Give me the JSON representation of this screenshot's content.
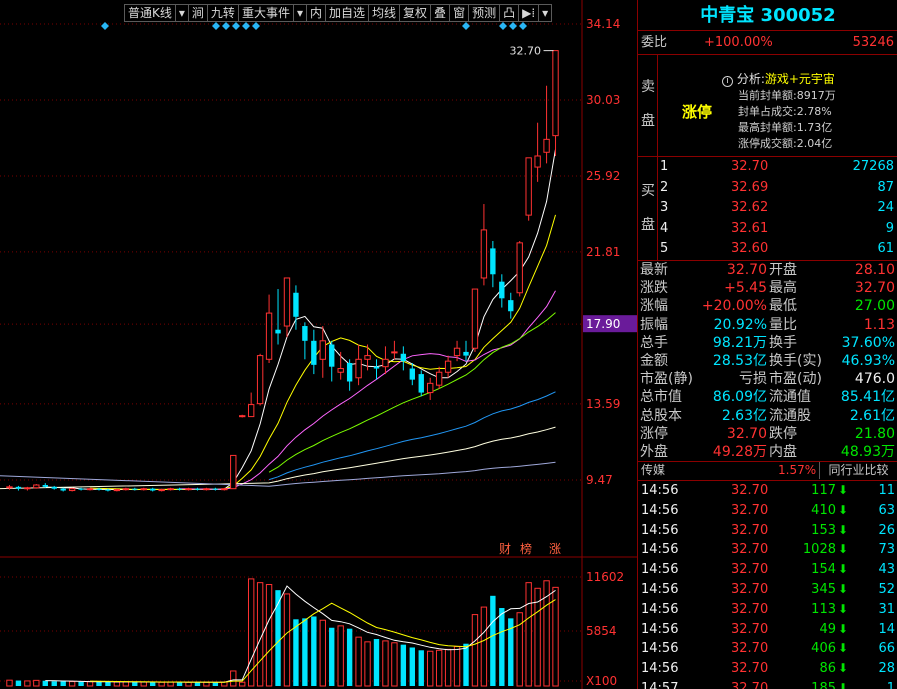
{
  "toolbar": {
    "items": [
      "普通K线",
      "▾",
      "涧",
      "九转",
      "重大事件",
      "▾",
      "内",
      "加自选",
      "均线",
      "复权",
      "叠",
      "窗",
      "预测",
      "凸",
      "▶⁞",
      "▾"
    ]
  },
  "chart": {
    "price_ticks": [
      "34.14",
      "30.03",
      "25.92",
      "21.81",
      "17.90",
      "13.59",
      "9.47"
    ],
    "high_label": "32.70",
    "highlight_price": "17.90",
    "volume_ticks": [
      "11602",
      "5854",
      "X100"
    ],
    "tags": [
      "财",
      "榜",
      "涨"
    ],
    "colors": {
      "up": "#ff3232",
      "down": "#00e5ff",
      "bg": "#000000",
      "grid": "#7a0000"
    }
  },
  "stock": {
    "title": "中青宝 300052",
    "weibi_label": "委比",
    "weibi_pct": "+100.00%",
    "weibi_num": "53246",
    "sell_label_1": "卖",
    "sell_label_2": "盘",
    "limit_up": "涨停",
    "analysis_title": "分析:",
    "analysis_topic": "游戏+元宇宙",
    "analysis_lines": [
      "当前封单额:8917万",
      "封单占成交:2.78%",
      "最高封单额:1.73亿",
      "涨停成交额:2.04亿"
    ],
    "buy_label_1": "买",
    "buy_label_2": "盘",
    "bids": [
      {
        "lvl": "1",
        "price": "32.70",
        "vol": "27268"
      },
      {
        "lvl": "2",
        "price": "32.69",
        "vol": "87"
      },
      {
        "lvl": "3",
        "price": "32.62",
        "vol": "24"
      },
      {
        "lvl": "4",
        "price": "32.61",
        "vol": "9"
      },
      {
        "lvl": "5",
        "price": "32.60",
        "vol": "61"
      }
    ],
    "stats": [
      {
        "l1": "最新",
        "v1": "32.70",
        "c1": "red",
        "l2": "开盘",
        "v2": "28.10",
        "c2": "red"
      },
      {
        "l1": "涨跌",
        "v1": "+5.45",
        "c1": "red",
        "l2": "最高",
        "v2": "32.70",
        "c2": "red"
      },
      {
        "l1": "涨幅",
        "v1": "+20.00%",
        "c1": "red",
        "l2": "最低",
        "v2": "27.00",
        "c2": "green"
      },
      {
        "l1": "振幅",
        "v1": "20.92%",
        "c1": "cyan",
        "l2": "量比",
        "v2": "1.13",
        "c2": "red"
      },
      {
        "l1": "总手",
        "v1": "98.21万",
        "c1": "cyan",
        "l2": "换手",
        "v2": "37.60%",
        "c2": "cyan"
      },
      {
        "l1": "金额",
        "v1": "28.53亿",
        "c1": "cyan",
        "l2": "换手(实)",
        "v2": "46.93%",
        "c2": "cyan"
      },
      {
        "l1": "市盈(静)",
        "v1": "亏损",
        "c1": "gray",
        "l2": "市盈(动)",
        "v2": "476.0",
        "c2": "white"
      },
      {
        "l1": "总市值",
        "v1": "86.09亿",
        "c1": "cyan",
        "l2": "流通值",
        "v2": "85.41亿",
        "c2": "cyan"
      },
      {
        "l1": "总股本",
        "v1": "2.63亿",
        "c1": "cyan",
        "l2": "流通股",
        "v2": "2.61亿",
        "c2": "cyan"
      },
      {
        "l1": "涨停",
        "v1": "32.70",
        "c1": "red",
        "l2": "跌停",
        "v2": "21.80",
        "c2": "green"
      },
      {
        "l1": "外盘",
        "v1": "49.28万",
        "c1": "red",
        "l2": "内盘",
        "v2": "48.93万",
        "c2": "green"
      }
    ],
    "industry": "传媒",
    "industry_pct": "1.57%",
    "compare_label": "同行业比较",
    "trades": [
      {
        "t": "14:56",
        "p": "32.70",
        "v": "117",
        "n": "11"
      },
      {
        "t": "14:56",
        "p": "32.70",
        "v": "410",
        "n": "63"
      },
      {
        "t": "14:56",
        "p": "32.70",
        "v": "153",
        "n": "26"
      },
      {
        "t": "14:56",
        "p": "32.70",
        "v": "1028",
        "n": "73"
      },
      {
        "t": "14:56",
        "p": "32.70",
        "v": "154",
        "n": "43"
      },
      {
        "t": "14:56",
        "p": "32.70",
        "v": "345",
        "n": "52"
      },
      {
        "t": "14:56",
        "p": "32.70",
        "v": "113",
        "n": "31"
      },
      {
        "t": "14:56",
        "p": "32.70",
        "v": "49",
        "n": "14"
      },
      {
        "t": "14:56",
        "p": "32.70",
        "v": "406",
        "n": "66"
      },
      {
        "t": "14:56",
        "p": "32.70",
        "v": "86",
        "n": "28"
      },
      {
        "t": "14:57",
        "p": "32.70",
        "v": "185",
        "n": "1"
      }
    ]
  },
  "candles": [
    {
      "o": 9.05,
      "c": 9.1,
      "h": 9.2,
      "l": 8.95,
      "v": 620
    },
    {
      "o": 9.1,
      "c": 9.0,
      "h": 9.15,
      "l": 8.9,
      "v": 580
    },
    {
      "o": 9.0,
      "c": 9.05,
      "h": 9.1,
      "l": 8.9,
      "v": 540
    },
    {
      "o": 9.05,
      "c": 9.2,
      "h": 9.25,
      "l": 9.0,
      "v": 600
    },
    {
      "o": 9.2,
      "c": 9.1,
      "h": 9.3,
      "l": 9.05,
      "v": 560
    },
    {
      "o": 9.1,
      "c": 9.0,
      "h": 9.15,
      "l": 8.95,
      "v": 500
    },
    {
      "o": 9.0,
      "c": 8.9,
      "h": 9.05,
      "l": 8.85,
      "v": 480
    },
    {
      "o": 8.9,
      "c": 9.0,
      "h": 9.05,
      "l": 8.85,
      "v": 470
    },
    {
      "o": 9.0,
      "c": 8.95,
      "h": 9.05,
      "l": 8.9,
      "v": 450
    },
    {
      "o": 8.95,
      "c": 9.0,
      "h": 9.05,
      "l": 8.9,
      "v": 460
    },
    {
      "o": 9.0,
      "c": 8.95,
      "h": 9.05,
      "l": 8.9,
      "v": 440
    },
    {
      "o": 8.95,
      "c": 8.9,
      "h": 9.0,
      "l": 8.85,
      "v": 430
    },
    {
      "o": 8.9,
      "c": 8.95,
      "h": 9.0,
      "l": 8.85,
      "v": 420
    },
    {
      "o": 8.95,
      "c": 9.0,
      "h": 9.05,
      "l": 8.9,
      "v": 440
    },
    {
      "o": 9.0,
      "c": 8.95,
      "h": 9.05,
      "l": 8.9,
      "v": 430
    },
    {
      "o": 8.95,
      "c": 9.0,
      "h": 9.05,
      "l": 8.9,
      "v": 420
    },
    {
      "o": 9.0,
      "c": 8.9,
      "h": 9.05,
      "l": 8.85,
      "v": 410
    },
    {
      "o": 8.9,
      "c": 8.95,
      "h": 9.0,
      "l": 8.85,
      "v": 400
    },
    {
      "o": 8.95,
      "c": 9.0,
      "h": 9.05,
      "l": 8.9,
      "v": 420
    },
    {
      "o": 9.0,
      "c": 8.95,
      "h": 9.05,
      "l": 8.9,
      "v": 410
    },
    {
      "o": 8.95,
      "c": 9.0,
      "h": 9.05,
      "l": 8.9,
      "v": 400
    },
    {
      "o": 9.0,
      "c": 8.95,
      "h": 9.05,
      "l": 8.9,
      "v": 390
    },
    {
      "o": 8.95,
      "c": 9.0,
      "h": 9.05,
      "l": 8.9,
      "v": 400
    },
    {
      "o": 9.0,
      "c": 8.95,
      "h": 9.05,
      "l": 8.9,
      "v": 410
    },
    {
      "o": 8.95,
      "c": 9.0,
      "h": 9.05,
      "l": 8.9,
      "v": 420
    },
    {
      "o": 9.0,
      "c": 10.8,
      "h": 10.8,
      "l": 9.0,
      "v": 1600
    },
    {
      "o": 12.9,
      "c": 12.95,
      "h": 13.0,
      "l": 12.85,
      "v": 400
    },
    {
      "o": 12.9,
      "c": 13.55,
      "h": 14.2,
      "l": 12.9,
      "v": 11400
    },
    {
      "o": 13.6,
      "c": 16.2,
      "h": 16.3,
      "l": 13.5,
      "v": 11000
    },
    {
      "o": 16.0,
      "c": 18.5,
      "h": 19.5,
      "l": 15.8,
      "v": 10800
    },
    {
      "o": 17.6,
      "c": 17.4,
      "h": 19.8,
      "l": 16.8,
      "v": 10200
    },
    {
      "o": 17.8,
      "c": 20.4,
      "h": 20.4,
      "l": 17.2,
      "v": 9800
    },
    {
      "o": 19.6,
      "c": 18.3,
      "h": 20.0,
      "l": 17.6,
      "v": 7100
    },
    {
      "o": 17.8,
      "c": 17.0,
      "h": 18.0,
      "l": 16.0,
      "v": 7200
    },
    {
      "o": 17.0,
      "c": 15.7,
      "h": 17.6,
      "l": 15.2,
      "v": 7400
    },
    {
      "o": 16.0,
      "c": 17.0,
      "h": 17.8,
      "l": 15.0,
      "v": 7000
    },
    {
      "o": 16.8,
      "c": 15.6,
      "h": 17.0,
      "l": 14.8,
      "v": 6200
    },
    {
      "o": 15.3,
      "c": 15.5,
      "h": 16.4,
      "l": 14.9,
      "v": 6400
    },
    {
      "o": 15.8,
      "c": 14.8,
      "h": 16.0,
      "l": 14.3,
      "v": 6100
    },
    {
      "o": 15.0,
      "c": 16.0,
      "h": 16.8,
      "l": 14.6,
      "v": 5200
    },
    {
      "o": 16.0,
      "c": 16.2,
      "h": 16.8,
      "l": 15.4,
      "v": 4700
    },
    {
      "o": 15.6,
      "c": 15.5,
      "h": 16.0,
      "l": 14.9,
      "v": 5000
    },
    {
      "o": 15.6,
      "c": 16.0,
      "h": 16.7,
      "l": 15.2,
      "v": 4800
    },
    {
      "o": 16.4,
      "c": 16.4,
      "h": 17.0,
      "l": 16.0,
      "v": 4600
    },
    {
      "o": 16.3,
      "c": 15.9,
      "h": 16.7,
      "l": 15.4,
      "v": 4400
    },
    {
      "o": 15.5,
      "c": 14.9,
      "h": 15.8,
      "l": 14.6,
      "v": 4100
    },
    {
      "o": 15.2,
      "c": 14.2,
      "h": 15.4,
      "l": 14.0,
      "v": 3800
    },
    {
      "o": 14.2,
      "c": 14.7,
      "h": 15.0,
      "l": 13.8,
      "v": 3700
    },
    {
      "o": 14.6,
      "c": 15.3,
      "h": 15.6,
      "l": 14.4,
      "v": 3800
    },
    {
      "o": 15.3,
      "c": 15.9,
      "h": 16.2,
      "l": 15.0,
      "v": 3900
    },
    {
      "o": 16.2,
      "c": 16.6,
      "h": 17.0,
      "l": 15.9,
      "v": 4200
    },
    {
      "o": 16.4,
      "c": 16.2,
      "h": 17.0,
      "l": 15.9,
      "v": 4500
    },
    {
      "o": 16.6,
      "c": 19.8,
      "h": 19.8,
      "l": 16.4,
      "v": 7600
    },
    {
      "o": 20.4,
      "c": 23.0,
      "h": 24.4,
      "l": 20.0,
      "v": 8400
    },
    {
      "o": 22.0,
      "c": 20.6,
      "h": 22.4,
      "l": 19.9,
      "v": 9600
    },
    {
      "o": 20.2,
      "c": 19.3,
      "h": 20.6,
      "l": 18.8,
      "v": 8300
    },
    {
      "o": 19.2,
      "c": 18.6,
      "h": 19.6,
      "l": 18.2,
      "v": 7200
    },
    {
      "o": 19.6,
      "c": 22.3,
      "h": 22.4,
      "l": 19.4,
      "v": 7800
    },
    {
      "o": 23.8,
      "c": 26.9,
      "h": 26.9,
      "l": 23.5,
      "v": 11000
    },
    {
      "o": 26.4,
      "c": 27.0,
      "h": 28.8,
      "l": 25.6,
      "v": 10400
    },
    {
      "o": 27.2,
      "c": 27.9,
      "h": 30.8,
      "l": 26.6,
      "v": 11200
    },
    {
      "o": 28.1,
      "c": 32.7,
      "h": 32.7,
      "l": 27.0,
      "v": 10500
    }
  ]
}
